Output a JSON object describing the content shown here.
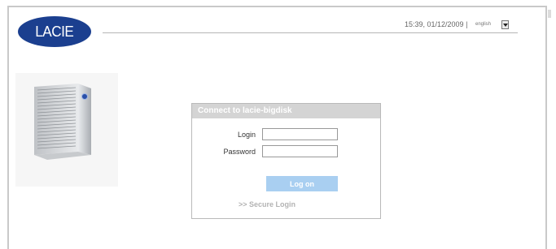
{
  "brand": {
    "logo_text": "LACIE"
  },
  "header": {
    "datetime": "15:39, 01/12/2009 |",
    "language": {
      "selected": "english"
    }
  },
  "login": {
    "title": "Connect to lacie-bigdisk",
    "login_label": "Login",
    "login_value": "",
    "password_label": "Password",
    "password_value": "",
    "submit_label": "Log on",
    "secure_link": ">> Secure Login"
  },
  "colors": {
    "logo_blue": "#1b3f8f",
    "button_blue": "#a9cff1",
    "header_gray": "#d4d4d4"
  }
}
